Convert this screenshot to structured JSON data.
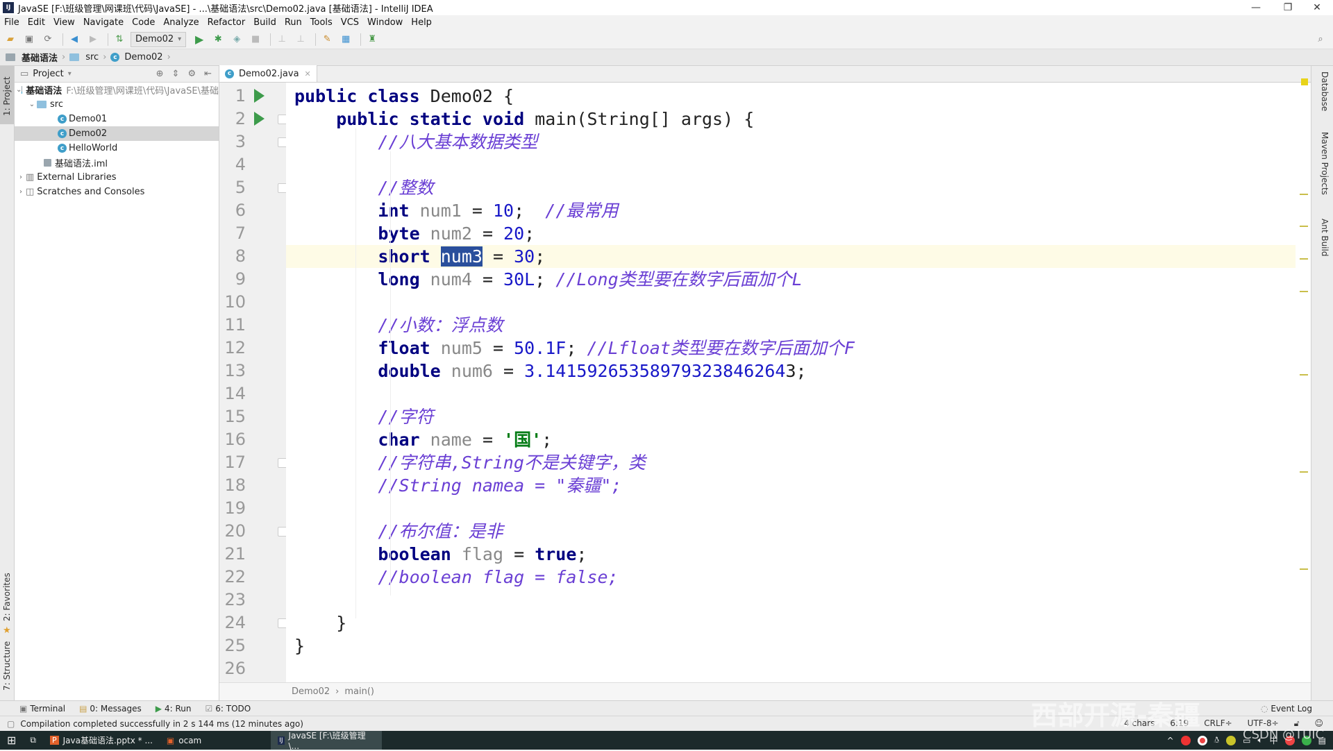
{
  "window": {
    "title": "JavaSE [F:\\班级管理\\网课班\\代码\\JavaSE] - ...\\基础语法\\src\\Demo02.java [基础语法] - IntelliJ IDEA",
    "logo": "IJ",
    "minimize": "—",
    "restore": "❐",
    "close": "✕"
  },
  "menu": [
    "File",
    "Edit",
    "View",
    "Navigate",
    "Code",
    "Analyze",
    "Refactor",
    "Build",
    "Run",
    "Tools",
    "VCS",
    "Window",
    "Help"
  ],
  "toolbar": {
    "run_config": "Demo02"
  },
  "navbar": {
    "crumbs": [
      "基础语法",
      "src",
      "Demo02"
    ]
  },
  "left_strip": {
    "project": "1: Project",
    "favorites": "2: Favorites",
    "structure": "7: Structure"
  },
  "project_panel": {
    "title": "Project",
    "root": {
      "name": "基础语法",
      "path": "F:\\班级管理\\网课班\\代码\\JavaSE\\基础"
    },
    "src": "src",
    "files": [
      "Demo01",
      "Demo02",
      "HelloWorld"
    ],
    "selected": "Demo02",
    "iml": "基础语法.iml",
    "external": "External Libraries",
    "scratches": "Scratches and Consoles"
  },
  "editor": {
    "tab": "Demo02.java",
    "current_line": 8,
    "lines": [
      [
        {
          "t": "public class ",
          "c": "kw"
        },
        {
          "t": "Demo02 {",
          "c": ""
        }
      ],
      [
        {
          "t": "    public static void ",
          "c": "kw"
        },
        {
          "t": "main(String[] args) {",
          "c": ""
        }
      ],
      [
        {
          "t": "        //八大基本数据类型",
          "c": "cm"
        }
      ],
      [],
      [
        {
          "t": "        //整数",
          "c": "cm"
        }
      ],
      [
        {
          "t": "        int ",
          "c": "kw"
        },
        {
          "t": "num1",
          "c": "var"
        },
        {
          "t": " = ",
          "c": ""
        },
        {
          "t": "10",
          "c": "num"
        },
        {
          "t": ";  ",
          "c": ""
        },
        {
          "t": "//最常用",
          "c": "cm"
        }
      ],
      [
        {
          "t": "        byte ",
          "c": "kw"
        },
        {
          "t": "num2",
          "c": "var"
        },
        {
          "t": " = ",
          "c": ""
        },
        {
          "t": "20",
          "c": "num"
        },
        {
          "t": ";",
          "c": ""
        }
      ],
      [
        {
          "t": "        short ",
          "c": "kw"
        },
        {
          "t": "num3",
          "c": "sel-word"
        },
        {
          "t": " = ",
          "c": ""
        },
        {
          "t": "30",
          "c": "num"
        },
        {
          "t": ";",
          "c": ""
        }
      ],
      [
        {
          "t": "        long ",
          "c": "kw"
        },
        {
          "t": "num4",
          "c": "var"
        },
        {
          "t": " = ",
          "c": ""
        },
        {
          "t": "30L",
          "c": "num"
        },
        {
          "t": "; ",
          "c": ""
        },
        {
          "t": "//Long类型要在数字后面加个L",
          "c": "cm"
        }
      ],
      [],
      [
        {
          "t": "        //小数：浮点数",
          "c": "cm"
        }
      ],
      [
        {
          "t": "        float ",
          "c": "kw"
        },
        {
          "t": "num5",
          "c": "var"
        },
        {
          "t": " = ",
          "c": ""
        },
        {
          "t": "50.1F",
          "c": "num"
        },
        {
          "t": "; ",
          "c": ""
        },
        {
          "t": "//Lfloat类型要在数字后面加个F",
          "c": "cm"
        }
      ],
      [
        {
          "t": "        double ",
          "c": "kw"
        },
        {
          "t": "num6",
          "c": "var"
        },
        {
          "t": " = ",
          "c": ""
        },
        {
          "t": "3.14159265358979323846264",
          "c": "num"
        },
        {
          "t": "3;",
          "c": ""
        }
      ],
      [],
      [
        {
          "t": "        //字符",
          "c": "cm"
        }
      ],
      [
        {
          "t": "        char ",
          "c": "kw"
        },
        {
          "t": "name",
          "c": "var"
        },
        {
          "t": " = ",
          "c": ""
        },
        {
          "t": "'国'",
          "c": "str"
        },
        {
          "t": ";",
          "c": ""
        }
      ],
      [
        {
          "t": "        //字符串,String不是关键字，类",
          "c": "cm"
        }
      ],
      [
        {
          "t": "        //String namea = \"秦疆\";",
          "c": "cm"
        }
      ],
      [],
      [
        {
          "t": "        //布尔值：是非",
          "c": "cm"
        }
      ],
      [
        {
          "t": "        boolean ",
          "c": "kw"
        },
        {
          "t": "flag",
          "c": "var"
        },
        {
          "t": " = ",
          "c": ""
        },
        {
          "t": "true",
          "c": "kw"
        },
        {
          "t": ";",
          "c": ""
        }
      ],
      [
        {
          "t": "        //boolean flag = false;",
          "c": "cm"
        }
      ],
      [],
      [
        {
          "t": "    }",
          "c": ""
        }
      ],
      [
        {
          "t": "}",
          "c": ""
        }
      ],
      []
    ],
    "run_lines": [
      1,
      2
    ],
    "fold_lines": [
      2,
      3,
      5,
      17,
      20,
      24
    ],
    "breadcrumb": [
      "Demo02",
      "main()"
    ]
  },
  "right_strip": [
    "Database",
    "Maven Projects",
    "Ant Build"
  ],
  "bottom_tabs": [
    "Terminal",
    "0: Messages",
    "4: Run",
    "6: TODO"
  ],
  "status": {
    "message": "Compilation completed successfully in 2 s 144 ms (12 minutes ago)",
    "chars": "4 chars",
    "position": "6:19",
    "line_sep": "CRLF÷",
    "encoding": "UTF-8÷",
    "event_log": "Event Log"
  },
  "taskbar": {
    "items": [
      "Java基础语法.pptx * ...",
      "ocam",
      "JavaSE [F:\\班级管理\\..."
    ],
    "active": 2
  },
  "overlay": {
    "watermark": "西部开源-秦疆",
    "csdn": "CSDN @TUIC"
  }
}
